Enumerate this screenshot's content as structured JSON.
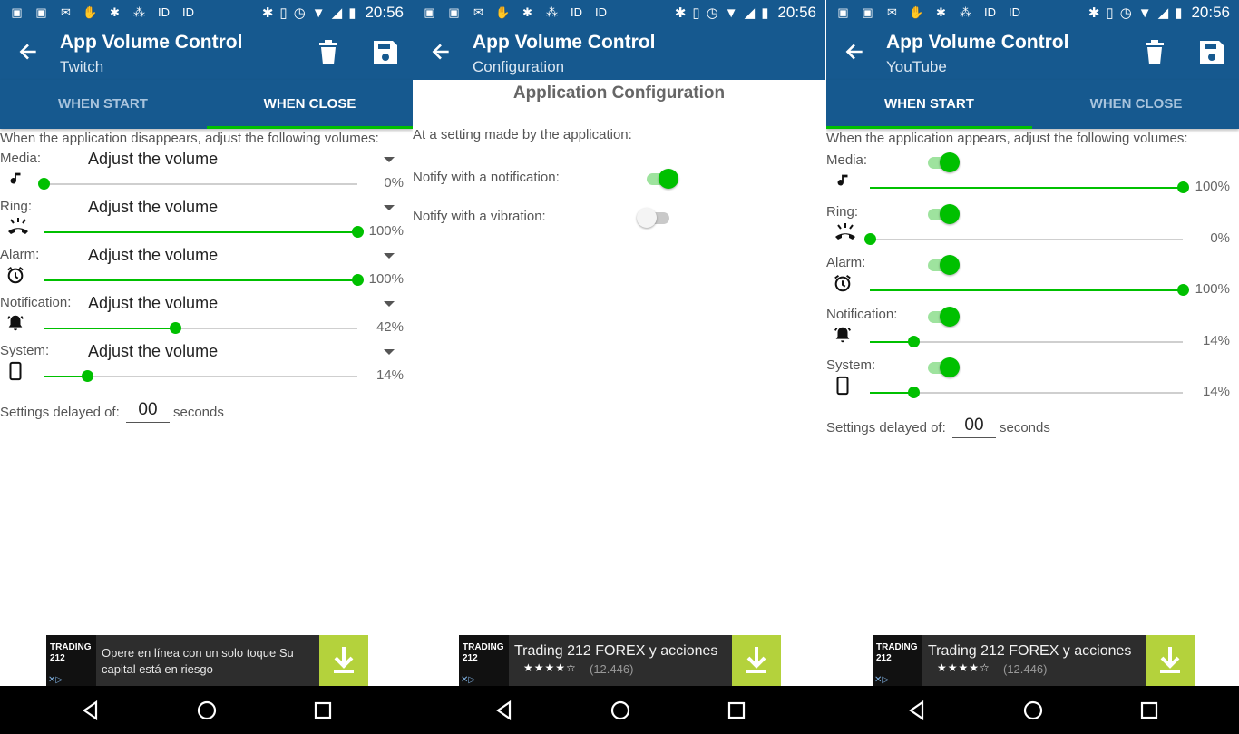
{
  "statusbar": {
    "time": "20:56"
  },
  "panels": [
    {
      "type": "volumes",
      "title": "App Volume Control",
      "subtitle": "Twitch",
      "tabs": [
        "WHEN START",
        "WHEN CLOSE"
      ],
      "active_tab": 1,
      "intro": "When the application disappears, adjust the following volumes:",
      "control": "dropdown",
      "rows": [
        {
          "label": "Media:",
          "icon": "music-note-icon",
          "mode": "Adjust the volume",
          "value": 0,
          "pct": "0%"
        },
        {
          "label": "Ring:",
          "icon": "ringing-phone-icon",
          "mode": "Adjust the volume",
          "value": 100,
          "pct": "100%"
        },
        {
          "label": "Alarm:",
          "icon": "alarm-clock-icon",
          "mode": "Adjust the volume",
          "value": 100,
          "pct": "100%"
        },
        {
          "label": "Notification:",
          "icon": "bell-icon",
          "mode": "Adjust the volume",
          "value": 42,
          "pct": "42%"
        },
        {
          "label": "System:",
          "icon": "smartphone-icon",
          "mode": "Adjust the volume",
          "value": 14,
          "pct": "14%"
        }
      ],
      "delay_label": "Settings delayed of:",
      "delay_value": "00",
      "delay_unit": "seconds",
      "ad": {
        "kind": "text",
        "logo": "TRADING 212",
        "text": "Opere en línea con un solo toque Su capital está en riesgo"
      }
    },
    {
      "type": "config",
      "title": "App Volume Control",
      "subtitle": "Configuration",
      "heading": "Application Configuration",
      "intro": "At a setting made by the application:",
      "options": [
        {
          "label": "Notify with a notification:",
          "on": true
        },
        {
          "label": "Notify with a vibration:",
          "on": false
        }
      ],
      "ad": {
        "kind": "app",
        "logo": "TRADING 212",
        "title": "Trading 212 FOREX y acciones",
        "stars": "★★★★☆",
        "count": "(12.446)"
      }
    },
    {
      "type": "volumes",
      "title": "App Volume Control",
      "subtitle": "YouTube",
      "tabs": [
        "WHEN START",
        "WHEN CLOSE"
      ],
      "active_tab": 0,
      "intro": "When the application appears, adjust the following volumes:",
      "control": "switch",
      "rows": [
        {
          "label": "Media:",
          "icon": "music-note-icon",
          "on": true,
          "value": 100,
          "pct": "100%"
        },
        {
          "label": "Ring:",
          "icon": "ringing-phone-icon",
          "on": true,
          "value": 0,
          "pct": "0%"
        },
        {
          "label": "Alarm:",
          "icon": "alarm-clock-icon",
          "on": true,
          "value": 100,
          "pct": "100%"
        },
        {
          "label": "Notification:",
          "icon": "bell-icon",
          "on": true,
          "value": 14,
          "pct": "14%"
        },
        {
          "label": "System:",
          "icon": "smartphone-icon",
          "on": true,
          "value": 14,
          "pct": "14%"
        }
      ],
      "delay_label": "Settings delayed of:",
      "delay_value": "00",
      "delay_unit": "seconds",
      "ad": {
        "kind": "app",
        "logo": "TRADING 212",
        "title": "Trading 212 FOREX y acciones",
        "stars": "★★★★☆",
        "count": "(12.446)"
      }
    }
  ],
  "colors": {
    "primary": "#16598f",
    "accent": "#00c000",
    "ad_button": "#b4d23c"
  },
  "navbar": {
    "icons": [
      "back-triangle-icon",
      "home-circle-icon",
      "recents-square-icon"
    ]
  }
}
